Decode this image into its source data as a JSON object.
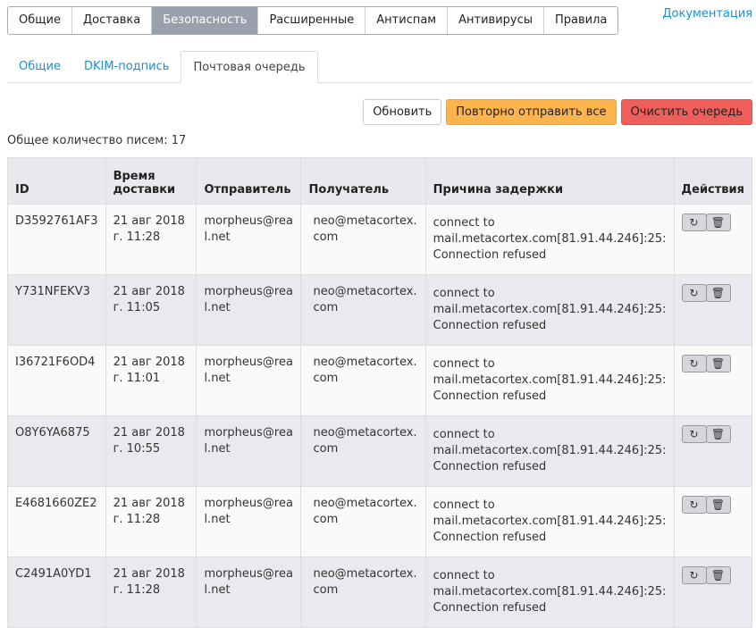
{
  "top_tabs": [
    "Общие",
    "Доставка",
    "Безопасность",
    "Расширенные",
    "Антиспам",
    "Антивирусы",
    "Правила"
  ],
  "active_top_tab": "Безопасность",
  "doc_link": "Документация",
  "sub_tabs": [
    "Общие",
    "DKIM-подпись",
    "Почтовая очередь"
  ],
  "buttons": {
    "refresh": "Обновить",
    "resend_all": "Повторно отправить все",
    "clear": "Очистить очередь"
  },
  "colors": {
    "accent": "#1a8fd6",
    "resend": "#fdb44d",
    "clear": "#ee5f5b",
    "active_tab": "#9aa0ab"
  },
  "total": "Общее количество писем: 17",
  "columns": [
    "ID",
    "Время доставки",
    "Отправитель",
    "Получатель",
    "Причина задержки",
    "Действия"
  ],
  "rows": [
    {
      "id": "D3592761AF3",
      "time": "21 авг 2018 г. 11:28",
      "sender": "morpheus@real.net",
      "recipient": "neo@metacortex.com",
      "reason": "connect to mail.metacortex.com[81.91.44.246]:25: Connection refused"
    },
    {
      "id": "Y731NFEKV3",
      "time": "21 авг 2018 г. 11:05",
      "sender": "morpheus@real.net",
      "recipient": "neo@metacortex.com",
      "reason": "connect to mail.metacortex.com[81.91.44.246]:25: Connection refused"
    },
    {
      "id": "I36721F6OD4",
      "time": "21 авг 2018 г. 11:01",
      "sender": "morpheus@real.net",
      "recipient": "neo@metacortex.com",
      "reason": "connect to mail.metacortex.com[81.91.44.246]:25: Connection refused"
    },
    {
      "id": "O8Y6YA6875",
      "time": "21 авг 2018 г. 10:55",
      "sender": "morpheus@real.net",
      "recipient": "neo@metacortex.com",
      "reason": "connect to mail.metacortex.com[81.91.44.246]:25: Connection refused"
    },
    {
      "id": "E4681660ZE2",
      "time": "21 авг 2018 г. 11:28",
      "sender": "morpheus@real.net",
      "recipient": "neo@metacortex.com",
      "reason": "connect to mail.metacortex.com[81.91.44.246]:25: Connection refused"
    },
    {
      "id": "C2491A0YD1",
      "time": "21 авг 2018 г. 11:28",
      "sender": "morpheus@real.net",
      "recipient": "neo@metacortex.com",
      "reason": "connect to mail.metacortex.com[81.91.44.246]:25: Connection refused"
    }
  ],
  "row_icons": [
    "refresh-icon",
    "trash-icon"
  ]
}
